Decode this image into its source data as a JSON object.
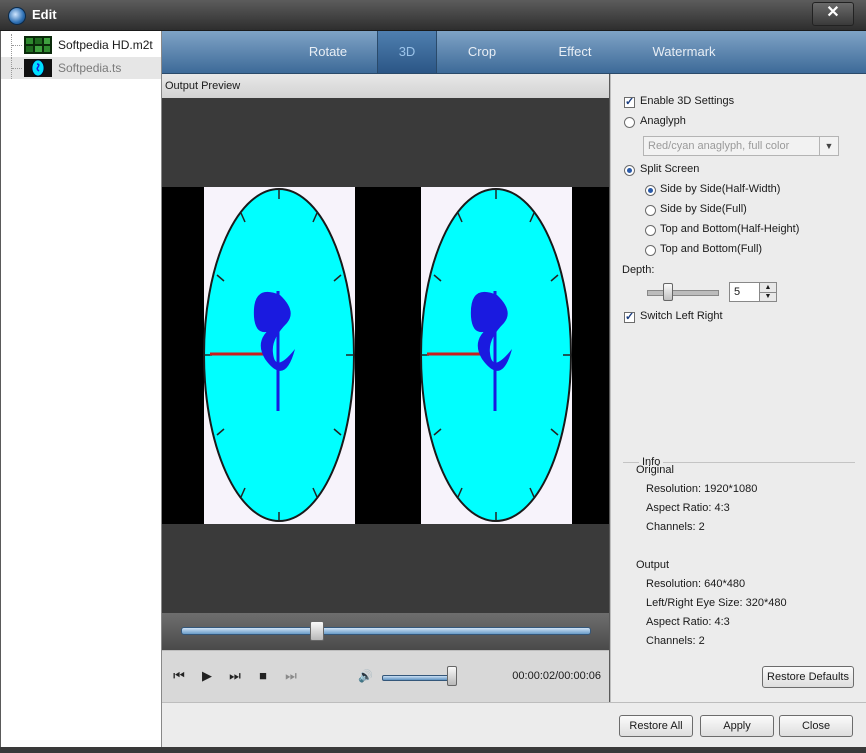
{
  "window": {
    "title": "Edit",
    "close_label": "✕"
  },
  "files": [
    {
      "name": "Softpedia HD.m2t",
      "selected": false
    },
    {
      "name": "Softpedia.ts",
      "selected": true
    }
  ],
  "tabs": [
    {
      "label": "Rotate",
      "active": false
    },
    {
      "label": "3D",
      "active": true
    },
    {
      "label": "Crop",
      "active": false
    },
    {
      "label": "Effect",
      "active": false
    },
    {
      "label": "Watermark",
      "active": false
    }
  ],
  "preview": {
    "label": "Output Preview",
    "seek_progress": 0.33,
    "volume_level": 1.0,
    "time": "00:00:02/00:00:06",
    "controls": {
      "prev_icon": "⏮",
      "play_icon": "▶",
      "next_icon": "⏭",
      "stop_icon": "■",
      "end_icon": "⏭",
      "volume_icon": "🔊"
    }
  },
  "settings": {
    "enable_3d": {
      "label": "Enable 3D Settings",
      "checked": true
    },
    "anaglyph": {
      "label": "Anaglyph",
      "selected": false,
      "dropdown_value": "Red/cyan anaglyph, full color"
    },
    "split_screen": {
      "label": "Split Screen",
      "selected": true
    },
    "split_options": [
      {
        "label": "Side by Side(Half-Width)",
        "selected": true
      },
      {
        "label": "Side by Side(Full)",
        "selected": false
      },
      {
        "label": "Top and Bottom(Half-Height)",
        "selected": false
      },
      {
        "label": "Top and Bottom(Full)",
        "selected": false
      }
    ],
    "depth": {
      "label": "Depth:",
      "value": "5"
    },
    "switch_left_right": {
      "label": "Switch Left Right",
      "checked": true
    }
  },
  "info": {
    "title": "Info",
    "original": {
      "heading": "Original",
      "resolution": "Resolution: 1920*1080",
      "aspect": "Aspect Ratio: 4:3",
      "channels": "Channels: 2"
    },
    "output": {
      "heading": "Output",
      "resolution": "Resolution: 640*480",
      "eye_size": "Left/Right Eye Size: 320*480",
      "aspect": "Aspect Ratio: 4:3",
      "channels": "Channels: 2"
    }
  },
  "buttons": {
    "restore_defaults": "Restore Defaults",
    "restore_all": "Restore All",
    "apply": "Apply",
    "close": "Close"
  },
  "colors": {
    "tab_active_text": "#9cc4ea",
    "clock_face": "#00ffff",
    "clock_logo": "#1a1ae0",
    "clock_hand": "#c81e1e"
  }
}
